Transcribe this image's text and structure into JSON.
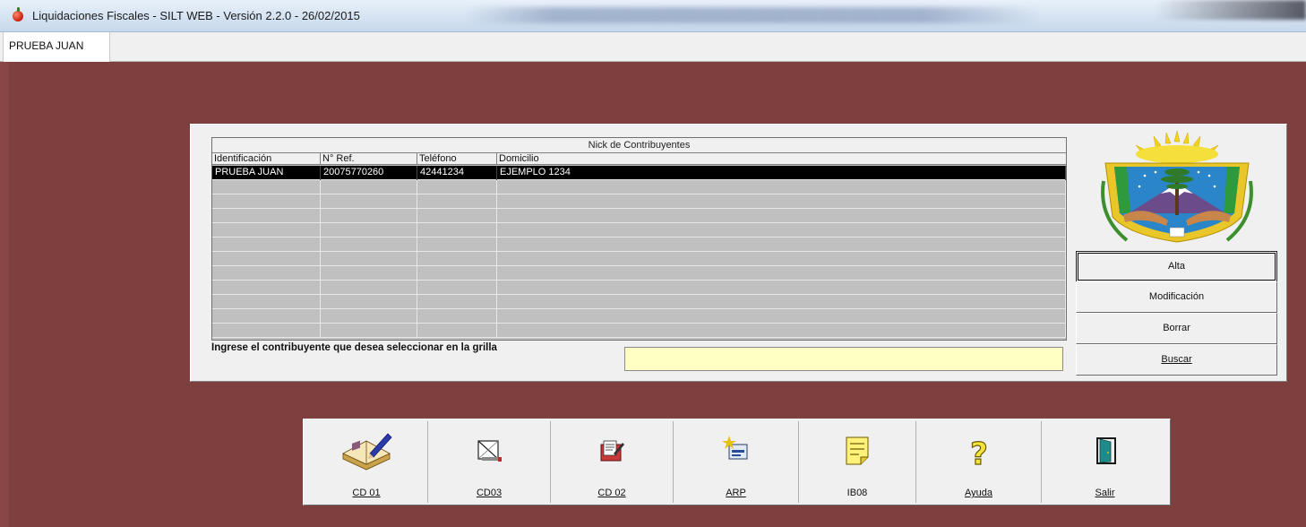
{
  "window": {
    "title": "Liquidaciones Fiscales - SILT WEB - Versión 2.2.0 - 26/02/2015"
  },
  "tabs": [
    {
      "label": "PRUEBA JUAN"
    }
  ],
  "grid": {
    "caption": "Nick de Contribuyentes",
    "columns": [
      "Identificación",
      "N° Ref.",
      "Teléfono",
      "Domicilio"
    ],
    "rows": [
      [
        "PRUEBA JUAN",
        "20075770260",
        "42441234",
        "EJEMPLO 1234"
      ]
    ],
    "empty_rows": 11
  },
  "search": {
    "prompt": "Ingrese el contribuyente que desea seleccionar en la grilla",
    "value": ""
  },
  "side_buttons": {
    "alta": "Alta",
    "modificacion": "Modificación",
    "borrar": "Borrar",
    "buscar": "Buscar"
  },
  "toolbar": {
    "buttons": [
      {
        "label": "CD 01",
        "icon": "book-pen-icon"
      },
      {
        "label": "CD03",
        "icon": "envelope-icon"
      },
      {
        "label": "CD 02",
        "icon": "folder-edit-icon"
      },
      {
        "label": "ARP",
        "icon": "card-sparkle-icon"
      },
      {
        "label": "IB08",
        "icon": "notepad-icon"
      },
      {
        "label": "Ayuda",
        "icon": "question-icon"
      },
      {
        "label": "Salir",
        "icon": "exit-door-icon"
      }
    ]
  },
  "colors": {
    "background": "#7e3f3f",
    "panel": "#f0f0f0",
    "grid_empty": "#c0c0c0",
    "selected_row": "#000000",
    "search_field": "#ffffc4"
  }
}
